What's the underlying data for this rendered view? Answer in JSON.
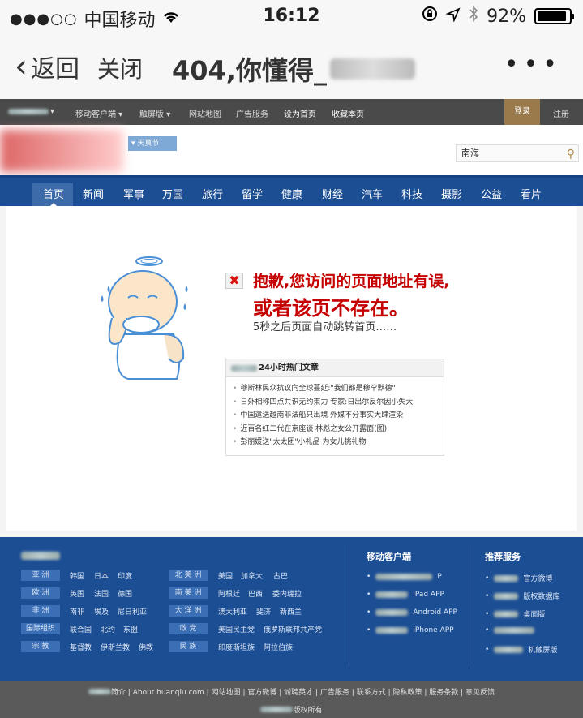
{
  "status_bar": {
    "carrier": "中国移动",
    "time": "16:12",
    "battery": "92%",
    "battery_level": 0.92
  },
  "browser": {
    "back_label": "返回",
    "close_label": "关闭",
    "title_prefix": "404,你懂得_"
  },
  "topbar": {
    "items": [
      "移动客户端 ▾",
      "触屏版 ▾",
      "网站地图",
      "广告服务",
      "设为首页",
      "收藏本页"
    ],
    "login": "登录",
    "register": "注册"
  },
  "header": {
    "channel_label": "天真节",
    "search_value": "南海"
  },
  "channels": [
    "首页",
    "新闻",
    "军事",
    "万国",
    "旅行",
    "留学",
    "健康",
    "财经",
    "汽车",
    "科技",
    "摄影",
    "公益",
    "看片"
  ],
  "error": {
    "line1": "抱歉,您访问的页面地址有误,",
    "line2": "或者该页不存在。",
    "line3": "5秒之后页面自动跳转首页……"
  },
  "hot": {
    "title": "24小时热门文章",
    "items": [
      "穆斯林民众抗议向全球蔓延:\"我们都是穆罕默德\"",
      "日外相称四点共识无约束力 专家:日出尔反尔因小失大",
      "中国遣送越南非法船只出境 外媒不分事实大肆渲染",
      "近百名红二代在京座谈 林彪之女公开露面(图)",
      "彭丽媛送\"太太团\"小礼品 为女儿挑礼物"
    ]
  },
  "footer": {
    "regions": [
      {
        "name": "亚 洲",
        "links": [
          "韩国",
          "日本",
          "印度"
        ]
      },
      {
        "name": "欧 洲",
        "links": [
          "英国",
          "法国",
          "德国"
        ]
      },
      {
        "name": "非 洲",
        "links": [
          "南非",
          "埃及",
          "尼日利亚"
        ]
      },
      {
        "name": "国际组织",
        "links": [
          "联合国",
          "北约",
          "东盟"
        ]
      },
      {
        "name": "宗 教",
        "links": [
          "基督教",
          "伊斯兰教",
          "佛教"
        ]
      }
    ],
    "regions2": [
      {
        "name": "北 美 洲",
        "links": [
          "美国",
          "加拿大",
          "古巴"
        ]
      },
      {
        "name": "南 美 洲",
        "links": [
          "阿根廷",
          "巴西",
          "委内瑞拉"
        ]
      },
      {
        "name": "大 洋 洲",
        "links": [
          "澳大利亚",
          "斐济",
          "新西兰"
        ]
      },
      {
        "name": "政 党",
        "links": [
          "美国民主党",
          "俄罗斯联邦共产党"
        ]
      },
      {
        "name": "民 族",
        "links": [
          "印度斯坦族",
          "阿拉伯族"
        ]
      }
    ],
    "mobile_title": "移动客户端",
    "mobile_links": [
      "P",
      "iPad APP",
      "Android APP",
      "iPhone APP"
    ],
    "rec_title": "推荐服务",
    "rec_links": [
      "官方微博",
      "版权数据库",
      "桌面版",
      "",
      "机触屏版"
    ]
  },
  "bottom": {
    "links": [
      "简介",
      "About huanqiu.com",
      "网站地图",
      "官方微博",
      "诚聘英才",
      "广告服务",
      "联系方式",
      "隐私政策",
      "服务条款",
      "意见反馈"
    ],
    "copyright": "版权所有"
  }
}
